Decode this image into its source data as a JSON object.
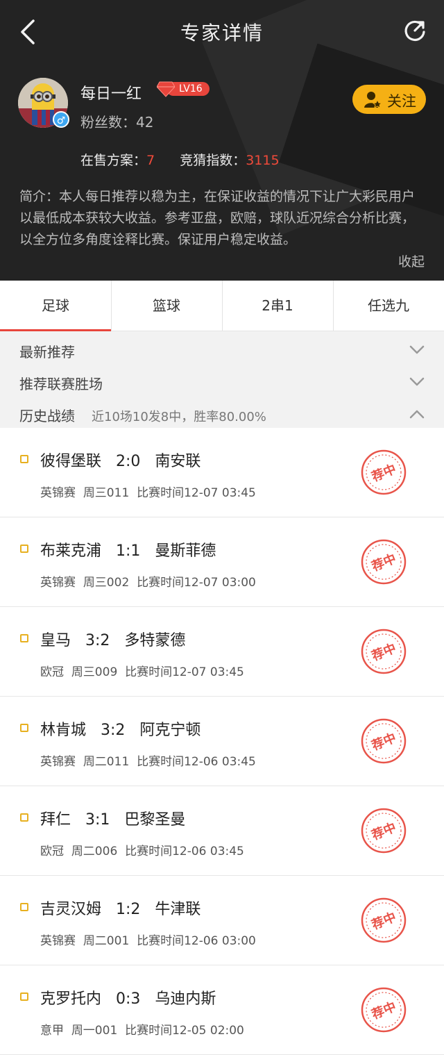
{
  "header": {
    "title": "专家详情",
    "back_icon": "back-chevron-icon",
    "share_icon": "refresh-share-icon"
  },
  "profile": {
    "name": "每日一红",
    "level": "LV16",
    "fans_label": "粉丝数：",
    "fans_count": "42",
    "follow_label": "关注",
    "on_sale_label": "在售方案：",
    "on_sale_count": "7",
    "index_label": "竞猜指数：",
    "index_value": "3115",
    "intro": "简介：本人每日推荐以稳为主，在保证收益的情况下让广大彩民用户以最低成本获较大收益。参考亚盘，欧赔，球队近况综合分析比赛，以全方位多角度诠释比赛。保证用户稳定收益。",
    "collapse_label": "收起"
  },
  "tabs": [
    "足球",
    "篮球",
    "2串1",
    "任选九"
  ],
  "active_tab": 0,
  "filters": {
    "latest": "最新推荐",
    "league_wins": "推荐联赛胜场",
    "history": "历史战绩",
    "history_summary": "近10场10发8中，胜率80.00%"
  },
  "stamp_text": "荐中",
  "matches": [
    {
      "home": "彼得堡联",
      "score": "2:0",
      "away": "南安联",
      "league": "英锦赛",
      "code": "周三011",
      "time": "比赛时间12-07 03:45"
    },
    {
      "home": "布莱克浦",
      "score": "1:1",
      "away": "曼斯菲德",
      "league": "英锦赛",
      "code": "周三002",
      "time": "比赛时间12-07 03:00"
    },
    {
      "home": "皇马",
      "score": "3:2",
      "away": "多特蒙德",
      "league": "欧冠",
      "code": "周三009",
      "time": "比赛时间12-07 03:45"
    },
    {
      "home": "林肯城",
      "score": "3:2",
      "away": "阿克宁顿",
      "league": "英锦赛",
      "code": "周二011",
      "time": "比赛时间12-06 03:45"
    },
    {
      "home": "拜仁",
      "score": "3:1",
      "away": "巴黎圣曼",
      "league": "欧冠",
      "code": "周二006",
      "time": "比赛时间12-06 03:45"
    },
    {
      "home": "吉灵汉姆",
      "score": "1:2",
      "away": "牛津联",
      "league": "英锦赛",
      "code": "周二001",
      "time": "比赛时间12-06 03:00"
    },
    {
      "home": "克罗托内",
      "score": "0:3",
      "away": "乌迪内斯",
      "league": "意甲",
      "code": "周一001",
      "time": "比赛时间12-05 02:00"
    }
  ],
  "colors": {
    "accent_red": "#e8453c",
    "follow_yellow": "#f5b014",
    "header_bg": "#232323"
  }
}
